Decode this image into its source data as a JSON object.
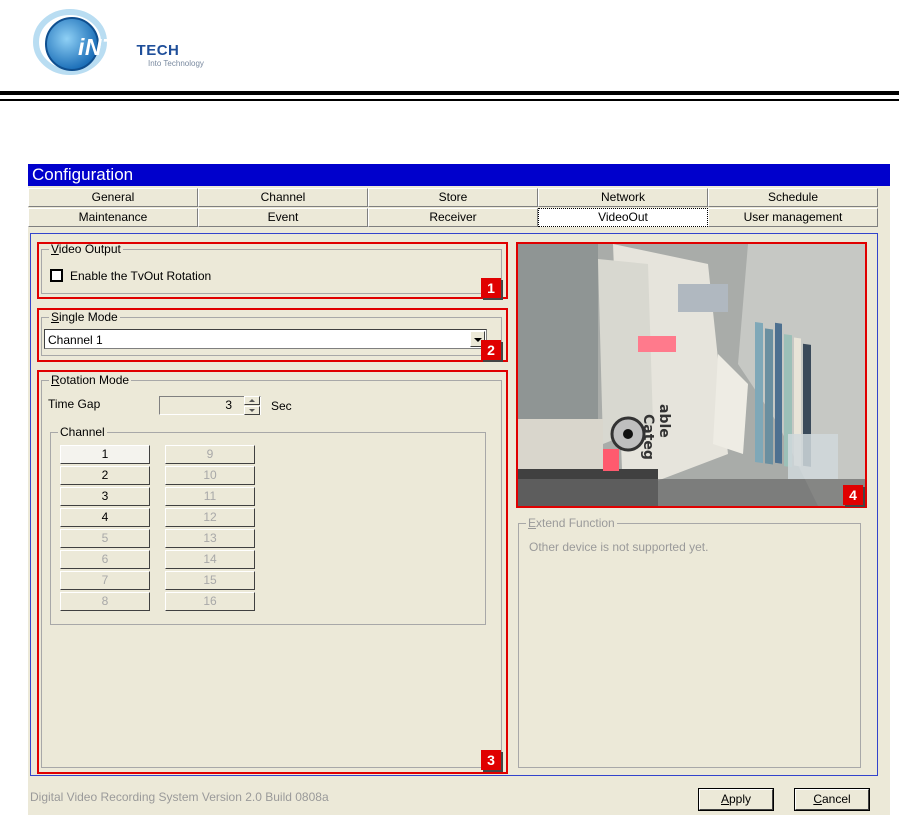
{
  "header": {
    "logo_main": "iNTO",
    "logo_suffix": "TECH",
    "logo_tagline": "Into Technology"
  },
  "window": {
    "title": "Configuration",
    "title_bar_color": "#0000cc",
    "tabs_row1": [
      "General",
      "Channel",
      "Store",
      "Network",
      "Schedule"
    ],
    "tabs_row2": [
      "Maintenance",
      "Event",
      "Receiver",
      "VideoOut",
      "User management"
    ],
    "active_tab": "VideoOut"
  },
  "video_output": {
    "group_hotkey": "V",
    "group_label": "ideo Output",
    "checkbox_label": "Enable the TvOut Rotation",
    "checked": false,
    "badge": "1"
  },
  "single_mode": {
    "group_hotkey": "S",
    "group_label": "ingle Mode",
    "selected": "Channel 1",
    "badge": "2"
  },
  "rotation_mode": {
    "group_hotkey": "R",
    "group_label": "otation Mode",
    "time_gap_label": "Time Gap",
    "time_gap_value": "3",
    "unit": "Sec",
    "channel_group_label": "Channel",
    "channels_col1": [
      {
        "label": "1",
        "enabled": true
      },
      {
        "label": "2",
        "enabled": true
      },
      {
        "label": "3",
        "enabled": true
      },
      {
        "label": "4",
        "enabled": true
      },
      {
        "label": "5",
        "enabled": false
      },
      {
        "label": "6",
        "enabled": false
      },
      {
        "label": "7",
        "enabled": false
      },
      {
        "label": "8",
        "enabled": false
      }
    ],
    "channels_col2": [
      {
        "label": "9",
        "enabled": false
      },
      {
        "label": "10",
        "enabled": false
      },
      {
        "label": "11",
        "enabled": false
      },
      {
        "label": "12",
        "enabled": false
      },
      {
        "label": "13",
        "enabled": false
      },
      {
        "label": "14",
        "enabled": false
      },
      {
        "label": "15",
        "enabled": false
      },
      {
        "label": "16",
        "enabled": false
      }
    ],
    "badge": "3"
  },
  "preview": {
    "badge": "4",
    "sign_text_1": "able",
    "sign_text_2": "Categ"
  },
  "extend_function": {
    "group_hotkey": "E",
    "group_label": "xtend Function",
    "message": "Other device is not supported yet."
  },
  "footer": {
    "version_text": "Digital Video Recording System Version 2.0 Build 0808a",
    "apply_hotkey": "A",
    "apply_rest": "pply",
    "cancel_hotkey": "C",
    "cancel_rest": "ancel"
  }
}
